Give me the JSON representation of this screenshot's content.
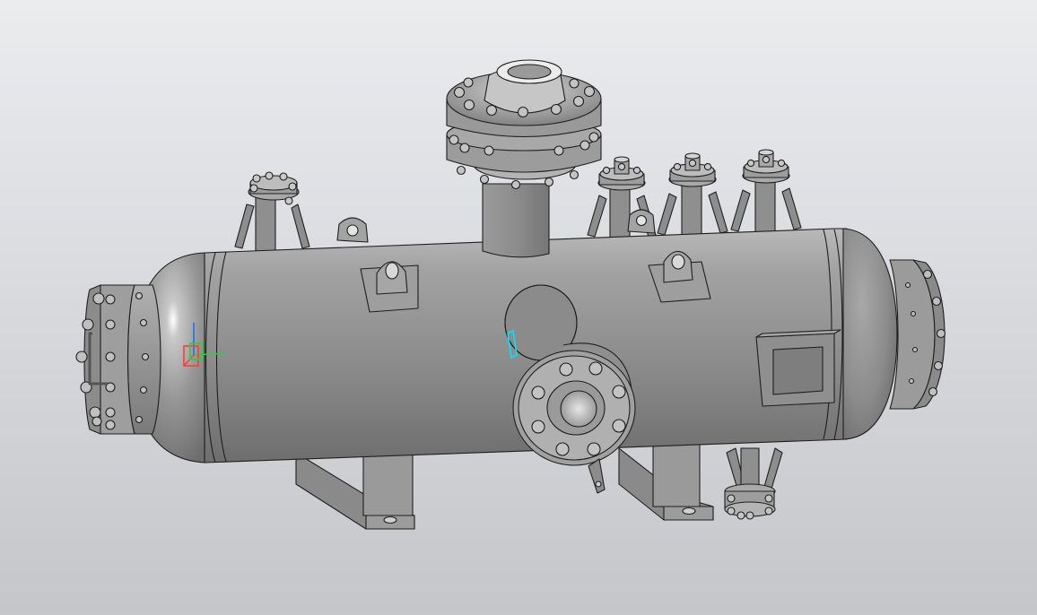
{
  "viewport": {
    "background_top": "#eaecee",
    "background_bottom": "#c4c6c9"
  },
  "model": {
    "body_color": "#8e8e8e",
    "edge_color": "#1e1e1e",
    "highlight_color": "#ffffff",
    "selection_color": "#00e5ff"
  },
  "triad": {
    "x_axis_color": "#2ecc40",
    "y_axis_color": "#1e6fff",
    "z_axis_color": "#ff3b3b"
  }
}
